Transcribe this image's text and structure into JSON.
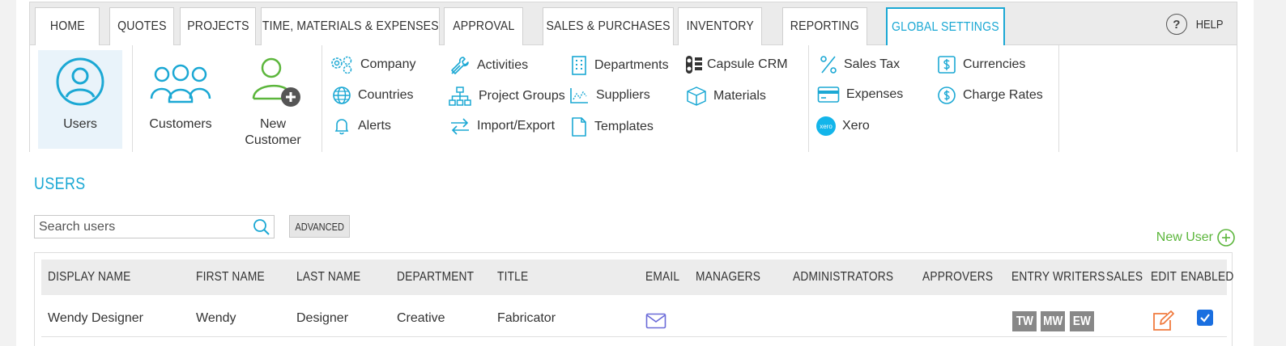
{
  "nav": {
    "tabs": [
      {
        "label": "HOME"
      },
      {
        "label": "QUOTES"
      },
      {
        "label": "PROJECTS"
      },
      {
        "label": "TIME, MATERIALS & EXPENSES"
      },
      {
        "label": "APPROVAL"
      },
      {
        "label": "SALES & PURCHASES"
      },
      {
        "label": "INVENTORY"
      },
      {
        "label": "REPORTING"
      },
      {
        "label": "GLOBAL SETTINGS"
      }
    ],
    "help_label": "HELP",
    "accent": "#1ba8d4"
  },
  "submenu": {
    "users": "Users",
    "customers": "Customers",
    "new_customer_line1": "New",
    "new_customer_line2": "Customer",
    "items": {
      "company": "Company",
      "countries": "Countries",
      "alerts": "Alerts",
      "activities": "Activities",
      "project_groups": "Project Groups",
      "import_export": "Import/Export",
      "departments": "Departments",
      "suppliers": "Suppliers",
      "templates": "Templates",
      "capsule_crm": "Capsule CRM",
      "materials": "Materials",
      "sales_tax": "Sales Tax",
      "expenses": "Expenses",
      "xero": "Xero",
      "currencies": "Currencies",
      "charge_rates": "Charge Rates"
    },
    "xero_badge": "xero"
  },
  "users_section": {
    "title": "USERS",
    "search_placeholder": "Search users",
    "advanced_label": "ADVANCED",
    "new_user_label": "New User",
    "new_user_color": "#5cb63c"
  },
  "table": {
    "headers": {
      "display_name": "DISPLAY NAME",
      "first_name": "FIRST NAME",
      "last_name": "LAST NAME",
      "department": "DEPARTMENT",
      "title": "TITLE",
      "email": "EMAIL",
      "managers": "MANAGERS",
      "administrators": "ADMINISTRATORS",
      "approvers": "APPROVERS",
      "entry_writers": "ENTRY WRITERS",
      "sales": "SALES",
      "edit": "EDIT",
      "enabled": "ENABLED"
    },
    "rows": [
      {
        "display_name": "Wendy Designer",
        "first_name": "Wendy",
        "last_name": "Designer",
        "department": "Creative",
        "title": "Fabricator",
        "badges": [
          "TW",
          "MW",
          "EW"
        ],
        "enabled": true
      }
    ]
  }
}
